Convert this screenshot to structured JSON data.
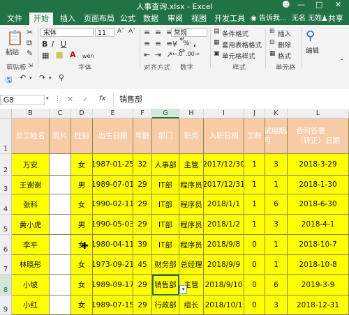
{
  "titlebar": {
    "title": "人事查询.xlsx - Excel",
    "user_icon": "account-icon"
  },
  "tabs": [
    {
      "label": "文件"
    },
    {
      "label": "开始"
    },
    {
      "label": "插入"
    },
    {
      "label": "页面布局"
    },
    {
      "label": "公式"
    },
    {
      "label": "数据"
    },
    {
      "label": "审阅"
    },
    {
      "label": "视图"
    },
    {
      "label": "开发工具"
    },
    {
      "label": "告诉我..."
    },
    {
      "label": "无名 无姓"
    },
    {
      "label": "共享"
    }
  ],
  "ribbon": {
    "paste": "粘贴",
    "font_name": "宋体",
    "font_size": "11",
    "bold": "B",
    "italic": "I",
    "underline": "U",
    "wen": "wén",
    "number_format": "常规",
    "percent": "%",
    "comma": ",",
    "cond_format": "条件格式",
    "table_format": "套用表格格式",
    "cell_style": "单元格样式",
    "insert": "插入",
    "delete": "删除",
    "format": "格式",
    "edit": "编辑",
    "groups": {
      "clipboard": "剪贴板",
      "font": "字体",
      "align": "对齐方式",
      "number": "数字",
      "style": "样式",
      "cells": "单元格"
    }
  },
  "formula_bar": {
    "name_box": "G8",
    "fx": "fx",
    "content": "销售部"
  },
  "columns": [
    "B",
    "C",
    "D",
    "E",
    "F",
    "G",
    "H",
    "I",
    "J",
    "K",
    "L"
  ],
  "rows": [
    {
      "num": "1",
      "cells": [
        "员工姓名",
        "照片",
        "性别",
        "出生日期",
        "年龄",
        "部门",
        "职务",
        "入职日期",
        "工龄",
        "试用期/月",
        "合同答署（转正）日期"
      ]
    },
    {
      "num": "2",
      "cells": [
        "万安",
        "",
        "女",
        "1987-01-25",
        "32",
        "人事部",
        "主管",
        "2017/12/30",
        "1",
        "3",
        "2018-3-29"
      ]
    },
    {
      "num": "3",
      "cells": [
        "王谢谢",
        "",
        "男",
        "1989-07-01",
        "29",
        "IT部",
        "程序员",
        "2017/12/31",
        "1",
        "1",
        "2018-1-30"
      ]
    },
    {
      "num": "4",
      "cells": [
        "张科",
        "",
        "女",
        "1990-02-11",
        "29",
        "IT部",
        "程序员",
        "2018/1/1",
        "1",
        "6",
        "2018-6-30"
      ]
    },
    {
      "num": "5",
      "cells": [
        "黄小虎",
        "",
        "男",
        "1990-05-03",
        "29",
        "IT部",
        "程序员",
        "2018/1/2",
        "1",
        "3",
        "2018-4-1"
      ]
    },
    {
      "num": "6",
      "cells": [
        "李平",
        "",
        "女",
        "1980-04-11",
        "39",
        "IT部",
        "程序员",
        "2018/9/8",
        "0",
        "1",
        "2018-10-7"
      ]
    },
    {
      "num": "7",
      "cells": [
        "林晓彤",
        "",
        "女",
        "1973-09-21",
        "45",
        "财务部",
        "总经理",
        "2018/9/9",
        "0",
        "1",
        "2018-10-8"
      ]
    },
    {
      "num": "8",
      "cells": [
        "小坡",
        "",
        "女",
        "1989-09-17",
        "29",
        "销售部",
        "主管",
        "2018/9/10",
        "0",
        "6",
        "2019-3-9"
      ]
    },
    {
      "num": "9",
      "cells": [
        "小红",
        "",
        "女",
        "1989-07-15",
        "29",
        "行政部",
        "组长",
        "2018/10/1",
        "0",
        "3",
        "2018-12-31"
      ]
    }
  ]
}
